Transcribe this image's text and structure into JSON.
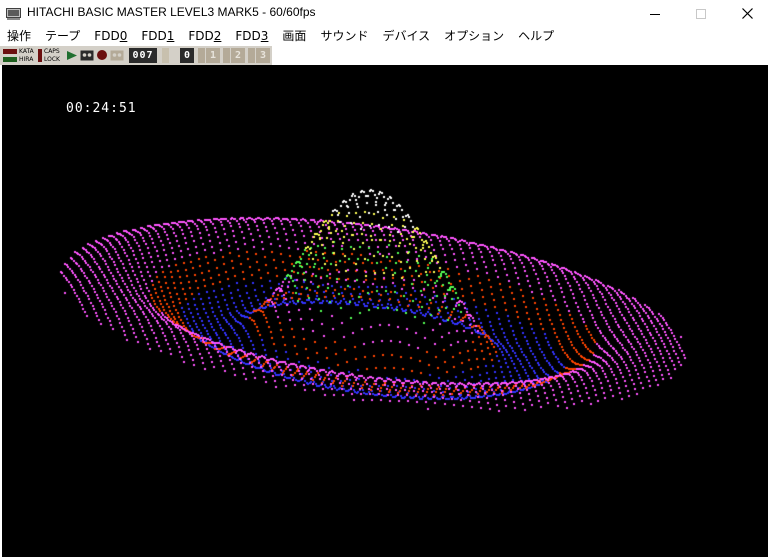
{
  "window": {
    "title": "HITACHI BASIC MASTER LEVEL3 MARK5 - 60/60fps",
    "icon": "computer-icon"
  },
  "controls": {
    "minimize_icon": "minimize-icon",
    "maximize_icon": "maximize-icon",
    "close_icon": "close-icon"
  },
  "menu": {
    "items": [
      {
        "label": "操作"
      },
      {
        "label": "テープ"
      },
      {
        "prefix": "FDD",
        "digit": "0"
      },
      {
        "prefix": "FDD",
        "digit": "1"
      },
      {
        "prefix": "FDD",
        "digit": "2"
      },
      {
        "prefix": "FDD",
        "digit": "3"
      },
      {
        "label": "画面"
      },
      {
        "label": "サウンド"
      },
      {
        "label": "デバイス"
      },
      {
        "label": "オプション"
      },
      {
        "label": "ヘルプ"
      }
    ]
  },
  "toolbar": {
    "kata_label": "KATA",
    "hira_label": "HIRA",
    "caps_label_1": "CAPS",
    "caps_label_2": "LOCK",
    "tape_counter": "007",
    "fdd": [
      "0",
      "1",
      "2",
      "3"
    ],
    "colors": {
      "kata_led": "#6b0f0f",
      "hira_led": "#1f5f1f",
      "fdd_active": "#2b2b2b",
      "fdd_inactive": "#b4aa98"
    }
  },
  "screen": {
    "clock": "00:24:51",
    "background": "#000000",
    "palette": {
      "white": "#ffffff",
      "yellow": "#ffff55",
      "green": "#55ff55",
      "magenta": "#ff55ff",
      "red": "#ff4400",
      "blue": "#3333ff"
    }
  }
}
